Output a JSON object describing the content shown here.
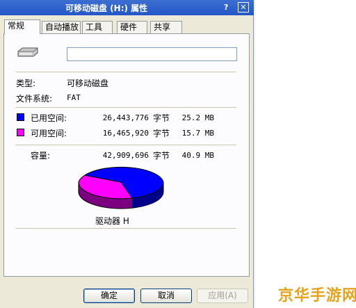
{
  "window": {
    "title": "可移动磁盘 (H:) 属性",
    "help_glyph": "?",
    "close_glyph": "✕"
  },
  "tabs": [
    {
      "label": "常规",
      "active": true
    },
    {
      "label": "自动播放",
      "active": false
    },
    {
      "label": "工具",
      "active": false
    },
    {
      "label": "硬件",
      "active": false
    },
    {
      "label": "共享",
      "active": false
    }
  ],
  "general": {
    "name_value": "",
    "type_label": "类型:",
    "type_value": "可移动磁盘",
    "fs_label": "文件系统:",
    "fs_value": "FAT",
    "used": {
      "label": "已用空间:",
      "bytes": "26,443,776",
      "unit": "字节",
      "size": "25.2 MB",
      "color": "#0000ff"
    },
    "free": {
      "label": "可用空间:",
      "bytes": "16,465,920",
      "unit": "字节",
      "size": "15.7 MB",
      "color": "#ff00ff"
    },
    "capacity": {
      "label": "容量:",
      "bytes": "42,909,696",
      "unit": "字节",
      "size": "40.9 MB"
    },
    "drive_label": "驱动器 H"
  },
  "buttons": {
    "ok": "确定",
    "cancel": "取消",
    "apply": "应用(A)"
  },
  "watermark": "京华手游网"
}
